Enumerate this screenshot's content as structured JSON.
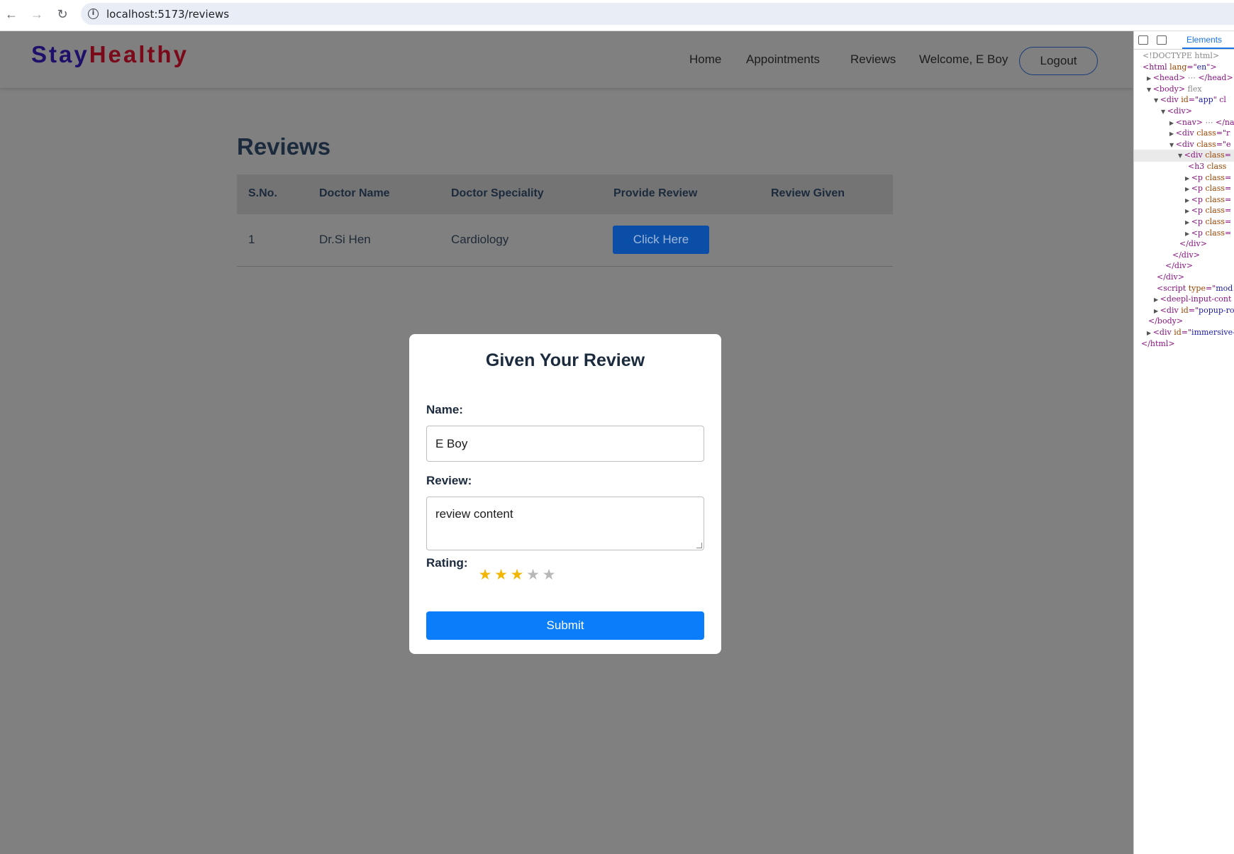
{
  "browser": {
    "url": "localhost:5173/reviews",
    "back_icon": "←",
    "forward_icon": "→",
    "reload_icon": "↻",
    "info_icon": "i"
  },
  "nav": {
    "brand_part1": "Stay",
    "brand_part2": "Healthy",
    "links": [
      "Home",
      "Appointments",
      "Reviews"
    ],
    "welcome": "Welcome, E Boy",
    "logout": "Logout"
  },
  "page": {
    "title": "Reviews",
    "table": {
      "headers": [
        "S.No.",
        "Doctor Name",
        "Doctor Speciality",
        "Provide Review",
        "Review Given"
      ],
      "rows": [
        {
          "sno": "1",
          "doctor_name": "Dr.Si Hen",
          "speciality": "Cardiology",
          "action": "Click Here",
          "review_given": ""
        }
      ]
    }
  },
  "modal": {
    "title": "Given Your Review",
    "name_label": "Name:",
    "name_value": "E Boy",
    "review_label": "Review:",
    "review_value": "review content",
    "rating_label": "Rating:",
    "rating_value": 3,
    "rating_max": 5,
    "star_glyph": "★",
    "submit": "Submit",
    "colors": {
      "star_on": "#f2b705",
      "star_off": "#b8b8b8",
      "submit_bg": "#0a7dfb"
    }
  },
  "devtools": {
    "tab": "Elements",
    "lines": [
      {
        "tri": "",
        "parts": [
          [
            "gray",
            "<!DOCTYPE html>"
          ]
        ]
      },
      {
        "tri": "",
        "parts": [
          [
            "tag",
            "<html "
          ],
          [
            "attr",
            "lang"
          ],
          [
            "tag",
            "=\""
          ],
          [
            "val",
            "en"
          ],
          [
            "tag",
            "\">"
          ]
        ]
      },
      {
        "tri": "▶",
        "parts": [
          [
            "tag",
            "<head>"
          ],
          [
            "gray",
            " ⋯ "
          ],
          [
            "tag",
            "</head>"
          ]
        ]
      },
      {
        "tri": "▼",
        "parts": [
          [
            "tag",
            "<body>"
          ],
          [
            "gray",
            " flex"
          ]
        ]
      },
      {
        "tri": "▼",
        "parts": [
          [
            "tag",
            "<div "
          ],
          [
            "attr",
            "id"
          ],
          [
            "tag",
            "=\""
          ],
          [
            "val",
            "app"
          ],
          [
            "tag",
            "\" cl"
          ]
        ]
      },
      {
        "tri": "▼",
        "parts": [
          [
            "tag",
            "<div>"
          ]
        ]
      },
      {
        "tri": "▶",
        "parts": [
          [
            "tag",
            "<nav>"
          ],
          [
            "gray",
            " ⋯ "
          ],
          [
            "tag",
            "</nav"
          ]
        ]
      },
      {
        "tri": "▶",
        "parts": [
          [
            "tag",
            "<div "
          ],
          [
            "attr",
            "class"
          ],
          [
            "tag",
            "=\"r"
          ]
        ]
      },
      {
        "tri": "▼",
        "parts": [
          [
            "tag",
            "<div "
          ],
          [
            "attr",
            "class"
          ],
          [
            "tag",
            "=\"e"
          ]
        ]
      },
      {
        "tri": "▼",
        "parts": [
          [
            "tag",
            "<div "
          ],
          [
            "attr",
            "class"
          ],
          [
            "tag",
            "="
          ]
        ]
      },
      {
        "tri": "",
        "parts": [
          [
            "tag",
            "<h3 "
          ],
          [
            "attr",
            "class"
          ]
        ]
      },
      {
        "tri": "▶",
        "parts": [
          [
            "tag",
            "<p "
          ],
          [
            "attr",
            "class"
          ],
          [
            "tag",
            "="
          ]
        ]
      },
      {
        "tri": "▶",
        "parts": [
          [
            "tag",
            "<p "
          ],
          [
            "attr",
            "class"
          ],
          [
            "tag",
            "="
          ]
        ]
      },
      {
        "tri": "▶",
        "parts": [
          [
            "tag",
            "<p "
          ],
          [
            "attr",
            "class"
          ],
          [
            "tag",
            "="
          ]
        ]
      },
      {
        "tri": "▶",
        "parts": [
          [
            "tag",
            "<p "
          ],
          [
            "attr",
            "class"
          ],
          [
            "tag",
            "="
          ]
        ]
      },
      {
        "tri": "▶",
        "parts": [
          [
            "tag",
            "<p "
          ],
          [
            "attr",
            "class"
          ],
          [
            "tag",
            "="
          ]
        ]
      },
      {
        "tri": "▶",
        "parts": [
          [
            "tag",
            "<p "
          ],
          [
            "attr",
            "class"
          ],
          [
            "tag",
            "="
          ]
        ]
      },
      {
        "tri": "",
        "parts": [
          [
            "tag",
            "</div>"
          ]
        ]
      },
      {
        "tri": "",
        "parts": [
          [
            "tag",
            "</div>"
          ]
        ]
      },
      {
        "tri": "",
        "parts": [
          [
            "tag",
            "</div>"
          ]
        ]
      },
      {
        "tri": "",
        "parts": [
          [
            "tag",
            "</div>"
          ]
        ]
      },
      {
        "tri": "",
        "parts": [
          [
            "tag",
            "<script "
          ],
          [
            "attr",
            "type"
          ],
          [
            "tag",
            "=\""
          ],
          [
            "val",
            "mod"
          ]
        ]
      },
      {
        "tri": "▶",
        "parts": [
          [
            "tag",
            "<deepl-input-cont"
          ]
        ]
      },
      {
        "tri": "▶",
        "parts": [
          [
            "tag",
            "<div "
          ],
          [
            "attr",
            "id"
          ],
          [
            "tag",
            "=\""
          ],
          [
            "val",
            "popup-ro"
          ]
        ]
      },
      {
        "tri": "",
        "parts": [
          [
            "tag",
            "</body>"
          ]
        ]
      },
      {
        "tri": "▶",
        "parts": [
          [
            "tag",
            "<div "
          ],
          [
            "attr",
            "id"
          ],
          [
            "tag",
            "=\""
          ],
          [
            "val",
            "immersive-"
          ]
        ]
      },
      {
        "tri": "",
        "parts": [
          [
            "tag",
            "</html>"
          ]
        ]
      }
    ]
  }
}
